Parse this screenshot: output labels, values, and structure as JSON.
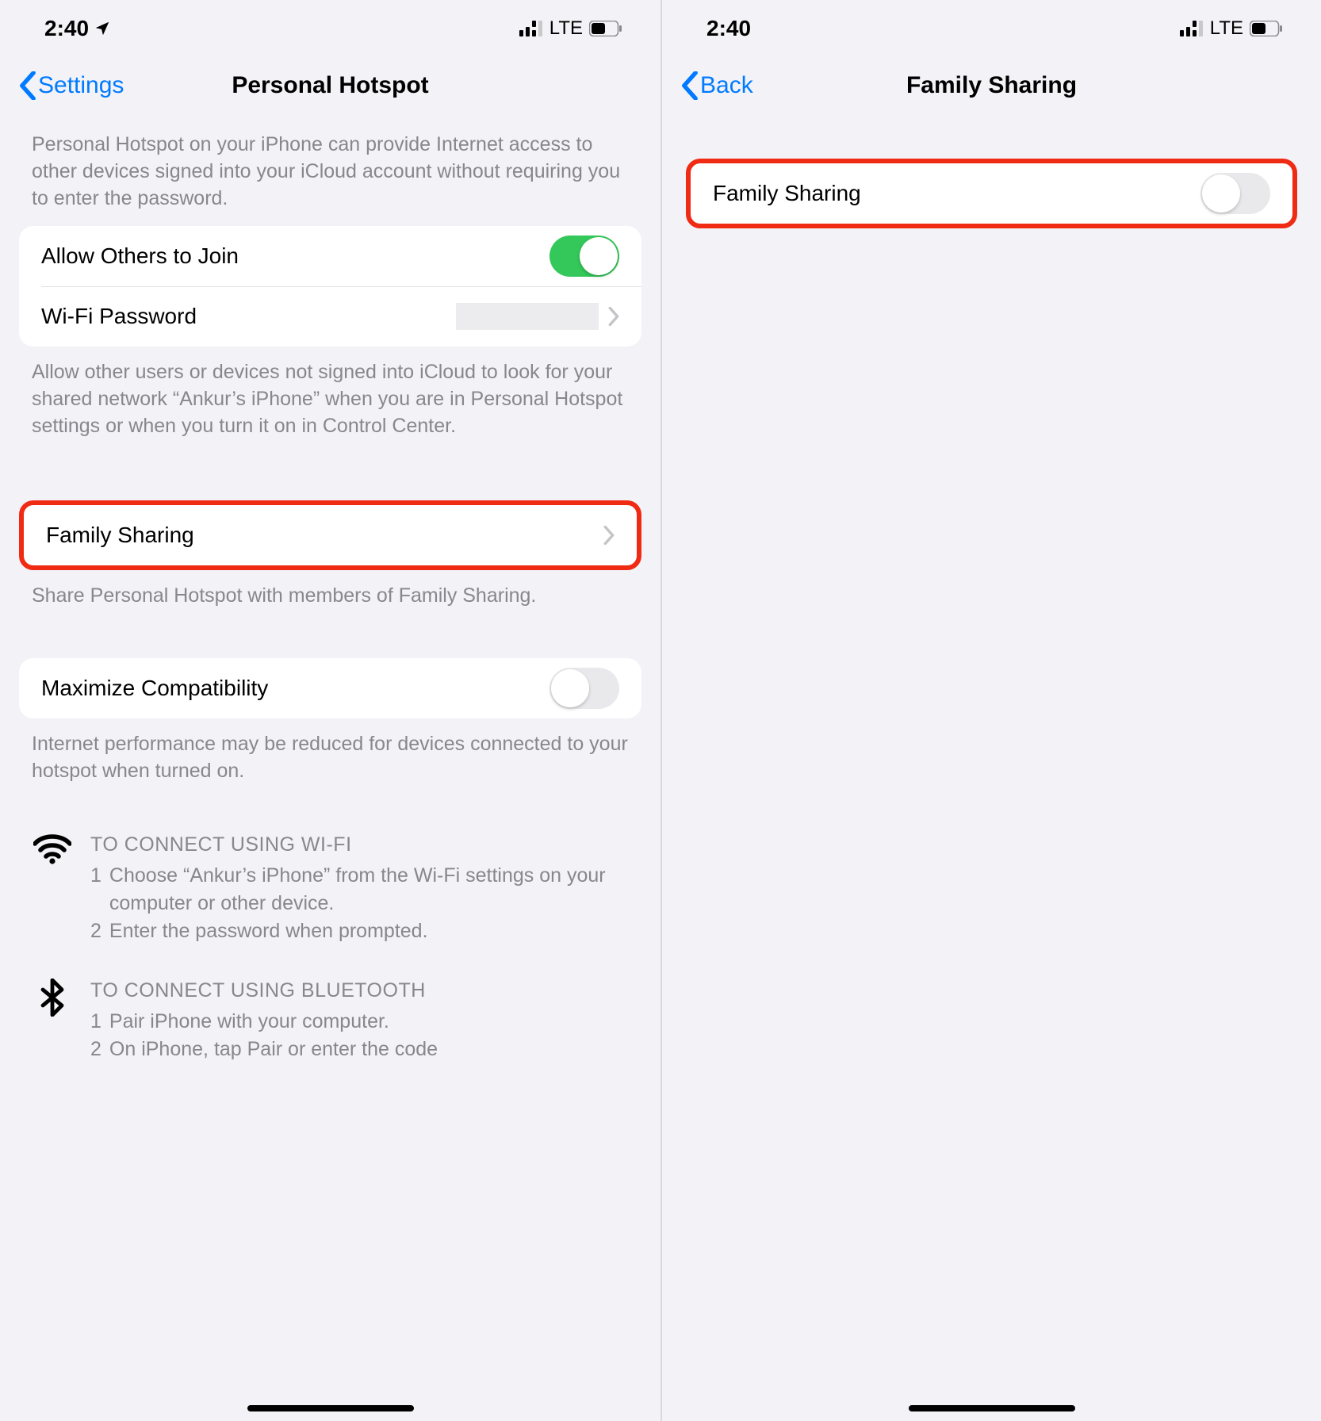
{
  "statusbar": {
    "time": "2:40",
    "network_label": "LTE"
  },
  "left": {
    "back_label": "Settings",
    "title": "Personal Hotspot",
    "intro": "Personal Hotspot on your iPhone can provide Internet access to other devices signed into your iCloud account without requiring you to enter the password.",
    "allow_others_label": "Allow Others to Join",
    "wifi_password_label": "Wi-Fi Password",
    "allow_others_footer": "Allow other users or devices not signed into iCloud to look for your shared network “Ankur’s iPhone” when you are in Personal Hotspot settings or when you turn it on in Control Center.",
    "family_sharing_label": "Family Sharing",
    "family_sharing_footer": "Share Personal Hotspot with members of Family Sharing.",
    "maximize_compat_label": "Maximize Compatibility",
    "maximize_compat_footer": "Internet performance may be reduced for devices connected to your hotspot when turned on.",
    "wifi_heading": "TO CONNECT USING WI-FI",
    "wifi_step1_num": "1",
    "wifi_step1_text": "Choose “Ankur’s iPhone” from the Wi-Fi settings on your computer or other device.",
    "wifi_step2_num": "2",
    "wifi_step2_text": "Enter the password when prompted.",
    "bt_heading": "TO CONNECT USING BLUETOOTH",
    "bt_step1_num": "1",
    "bt_step1_text": "Pair iPhone with your computer.",
    "bt_step2_num": "2",
    "bt_step2_text": "On iPhone, tap Pair or enter the code"
  },
  "right": {
    "back_label": "Back",
    "title": "Family Sharing",
    "row_label": "Family Sharing"
  }
}
